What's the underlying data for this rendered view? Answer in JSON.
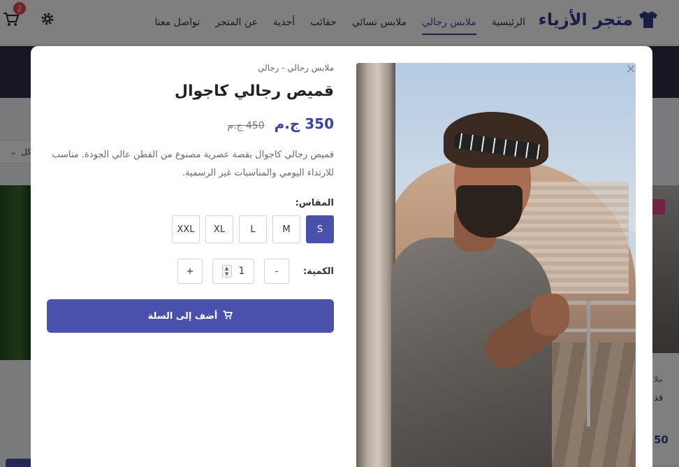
{
  "header": {
    "brand": "متجر الأزياء",
    "nav": [
      {
        "label": "الرئيسية"
      },
      {
        "label": "ملابس رجالي",
        "active": true
      },
      {
        "label": "ملابس نسائي"
      },
      {
        "label": "حقائب"
      },
      {
        "label": "أحذية"
      },
      {
        "label": "عن المتجر"
      },
      {
        "label": "تواصل معنا"
      }
    ],
    "cart_count": "2",
    "accent": "#3a44a3"
  },
  "background": {
    "filter_label": "كل",
    "side_category": "ملا",
    "side_name": "قد",
    "side_price": "50"
  },
  "product": {
    "breadcrumb": "ملابس رجالي - رجالي",
    "title": "قميص رجالي كاجوال",
    "price": "350 ج.م",
    "old_price": "450 ج.م",
    "description": "قميص رجالي كاجوال بقصة عصرية مصنوع من القطن عالي الجودة. مناسب للارتداء اليومي والمناسبات غير الرسمية.",
    "size_label": "المقاس:",
    "sizes": [
      "S",
      "M",
      "L",
      "XL",
      "XXL"
    ],
    "selected_size": "S",
    "quantity_label": "الكمية:",
    "quantity": "1",
    "minus": "-",
    "plus": "+",
    "add_to_cart": "أضف إلى السلة"
  },
  "colors": {
    "primary": "#4a51ad",
    "badge": "#e94557"
  }
}
